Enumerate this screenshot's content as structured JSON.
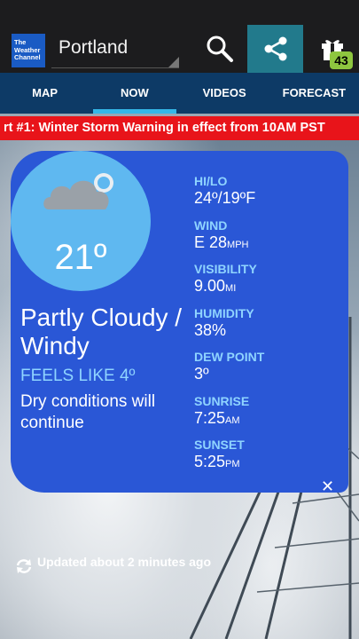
{
  "app": {
    "logo_lines": [
      "The",
      "Weather",
      "Channel"
    ],
    "city": "Portland",
    "badge_count": "43"
  },
  "tabs": [
    {
      "label": "MAP"
    },
    {
      "label": "NOW",
      "active": true
    },
    {
      "label": "VIDEOS"
    },
    {
      "label": "FORECAST"
    }
  ],
  "alert": {
    "text": "rt #1: Winter Storm Warning in effect from 10AM PST"
  },
  "current": {
    "temperature": "21º",
    "condition": "Partly Cloudy / Windy",
    "feels_like": "FEELS LIKE 4º",
    "summary": "Dry conditions will continue"
  },
  "stats": [
    {
      "label": "HI/LO",
      "value": "24º/19ºF",
      "unit": ""
    },
    {
      "label": "WIND",
      "value": "E 28",
      "unit": "MPH"
    },
    {
      "label": "VISIBILITY",
      "value": "9.00",
      "unit": "MI"
    },
    {
      "label": "HUMIDITY",
      "value": "38%",
      "unit": ""
    },
    {
      "label": "DEW POINT",
      "value": "3º",
      "unit": ""
    },
    {
      "label": "SUNRISE",
      "value": "7:25",
      "unit": "AM"
    },
    {
      "label": "SUNSET",
      "value": "5:25",
      "unit": "PM"
    }
  ],
  "footer": {
    "updated": "Updated about 2 minutes ago"
  },
  "icons": [
    "search-icon",
    "share-icon",
    "gift-icon",
    "partly-cloudy-icon",
    "close-icon",
    "refresh-icon"
  ]
}
